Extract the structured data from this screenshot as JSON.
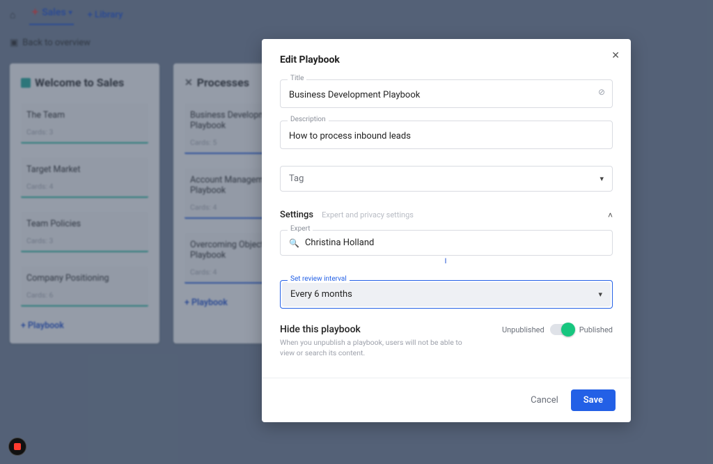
{
  "nav": {
    "active_tab": "Sales",
    "library_link": "+ Library",
    "back_label": "Back to overview"
  },
  "panels": {
    "welcome": {
      "title": "Welcome to Sales",
      "cards": [
        {
          "title": "The Team",
          "sub": "Cards: 3"
        },
        {
          "title": "Target Market",
          "sub": "Cards: 4"
        },
        {
          "title": "Team Policies",
          "sub": "Cards: 3"
        },
        {
          "title": "Company Positioning",
          "sub": "Cards: 6"
        }
      ],
      "add_label": "+ Playbook"
    },
    "processes": {
      "title": "Processes",
      "cards": [
        {
          "title": "Business Development Playbook",
          "sub": "Cards: 5"
        },
        {
          "title": "Account Management Playbook",
          "sub": "Cards: 4"
        },
        {
          "title": "Overcoming Objections Playbook",
          "sub": "Cards: 4"
        }
      ],
      "add_label": "+ Playbook"
    }
  },
  "modal": {
    "title": "Edit Playbook",
    "fields": {
      "title_label": "Title",
      "title_value": "Business Development Playbook",
      "desc_label": "Description",
      "desc_value": "How to process inbound leads",
      "tag_placeholder": "Tag"
    },
    "settings": {
      "label": "Settings",
      "sub": "Expert and privacy settings",
      "expert_label": "Expert",
      "expert_value": "Christina Holland",
      "interval_label": "Set review interval",
      "interval_value": "Every 6 months"
    },
    "hide": {
      "title": "Hide this playbook",
      "desc": "When you unpublish a playbook, users will not be able to view or search its content.",
      "unpublished_label": "Unpublished",
      "published_label": "Published"
    },
    "footer": {
      "cancel": "Cancel",
      "save": "Save"
    }
  }
}
